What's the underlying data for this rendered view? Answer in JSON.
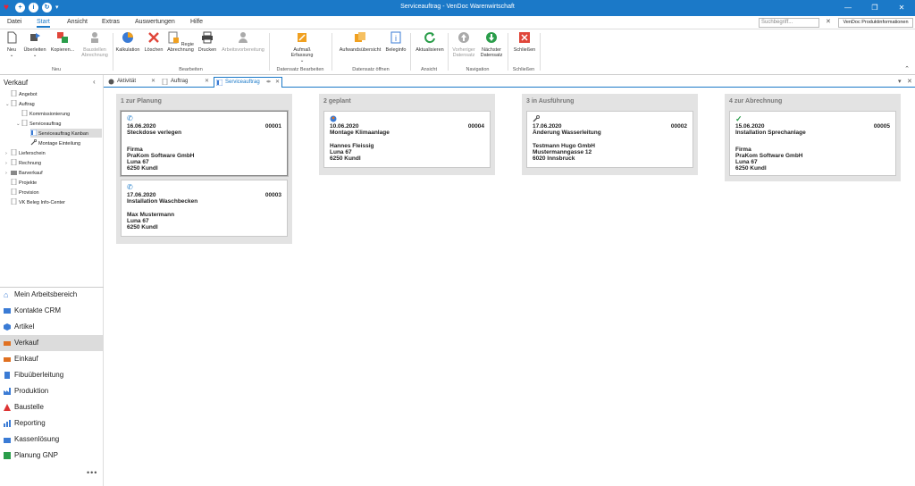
{
  "window": {
    "title": "Serviceauftrag - VenDoc Warenwirtschaft"
  },
  "menu": {
    "tabs": [
      "Datei",
      "Start",
      "Ansicht",
      "Extras",
      "Auswertungen",
      "Hilfe"
    ],
    "search_placeholder": "Suchbegriff...",
    "product_info": "VenDoc Produktinformationen"
  },
  "ribbon": {
    "new": "Neu",
    "transfer": "Überleiten",
    "copy": "Kopieren...",
    "site_billing": "Baustellen Abrechnung",
    "calculation": "Kalkulation",
    "delete": "Löschen",
    "regie_billing": "Regie Abrechnung",
    "print": "Drucken",
    "work_processing": "Arbeitsvorbereitung",
    "effort_entry": "Aufmaß Erfassung",
    "effort_overview": "Aufwandsübersicht",
    "doc_info": "Beleginfo",
    "refresh": "Aktualisieren",
    "prev_record": "Vorheriger Datensatz",
    "next_record": "Nächster Datensatz",
    "close": "Schließen",
    "groups": {
      "neu": "Neu",
      "bearbeiten": "Bearbeiten",
      "datensatz_bearbeiten": "Datensatz Bearbeiten",
      "datensatz_oeffnen": "Datensatz öffnen",
      "ansicht": "Ansicht",
      "navigation": "Navigation",
      "schliessen": "Schließen"
    }
  },
  "doc_tabs": [
    "Aktivität",
    "Auftrag",
    "Serviceauftrag"
  ],
  "sidebar": {
    "heading": "Verkauf",
    "tree": {
      "angebot": "Angebot",
      "auftrag": "Auftrag",
      "kommissionierung": "Kommissionierung",
      "serviceauftrag": "Serviceauftrag",
      "kanban": "Serviceauftrag Kanban",
      "montage": "Montage Einteilung",
      "lieferschein": "Lieferschein",
      "rechnung": "Rechnung",
      "barverkauf": "Barverkauf",
      "projekte": "Projekte",
      "provision": "Provision",
      "infocenter": "VK Beleg Info-Center"
    },
    "nav": [
      {
        "label": "Mein Arbeitsbereich",
        "color": "#3a7bd5"
      },
      {
        "label": "Kontakte CRM",
        "color": "#3a7bd5"
      },
      {
        "label": "Artikel",
        "color": "#3a7bd5"
      },
      {
        "label": "Verkauf",
        "color": "#e07020"
      },
      {
        "label": "Einkauf",
        "color": "#e07020"
      },
      {
        "label": "Fibuüberleitung",
        "color": "#3a7bd5"
      },
      {
        "label": "Produktion",
        "color": "#3a7bd5"
      },
      {
        "label": "Baustelle",
        "color": "#d33"
      },
      {
        "label": "Reporting",
        "color": "#3a7bd5"
      },
      {
        "label": "Kassenlösung",
        "color": "#3a7bd5"
      },
      {
        "label": "Planung GNP",
        "color": "#2a9d4a"
      }
    ],
    "more": "•••"
  },
  "kanban": {
    "columns": [
      {
        "title": "1 zur Planung",
        "cards": [
          {
            "icon": "phone-icon",
            "date": "16.06.2020",
            "number": "00001",
            "subject": "Steckdose verlegen",
            "lines": [
              "Firma",
              "PraKom Software GmbH",
              "Luna 67",
              "6250 Kundl"
            ]
          },
          {
            "icon": "phone-icon",
            "date": "17.06.2020",
            "number": "00003",
            "subject": "Installation Waschbecken",
            "lines": [
              "Max Mustermann",
              "Luna 67",
              "6250 Kundl"
            ]
          }
        ]
      },
      {
        "title": "2 geplant",
        "cards": [
          {
            "icon": "person-icon",
            "date": "10.06.2020",
            "number": "00004",
            "subject": "Montage Klimaanlage",
            "lines": [
              "Hannes Fleissig",
              "Luna 67",
              "6250 Kundl"
            ]
          }
        ]
      },
      {
        "title": "3 in Ausführung",
        "cards": [
          {
            "icon": "wrench-icon",
            "date": "17.06.2020",
            "number": "00002",
            "subject": "Änderung Wasserleitung",
            "lines": [
              "Testmann Hugo GmbH",
              "Mustermanngasse 12",
              "6020 Innsbruck"
            ]
          }
        ]
      },
      {
        "title": "4 zur Abrechnung",
        "cards": [
          {
            "icon": "check-icon",
            "date": "15.06.2020",
            "number": "00005",
            "subject": "Installation Sprechanlage",
            "lines": [
              "Firma",
              "PraKom Software GmbH",
              "Luna 67",
              "6250 Kundl"
            ]
          }
        ]
      }
    ]
  }
}
